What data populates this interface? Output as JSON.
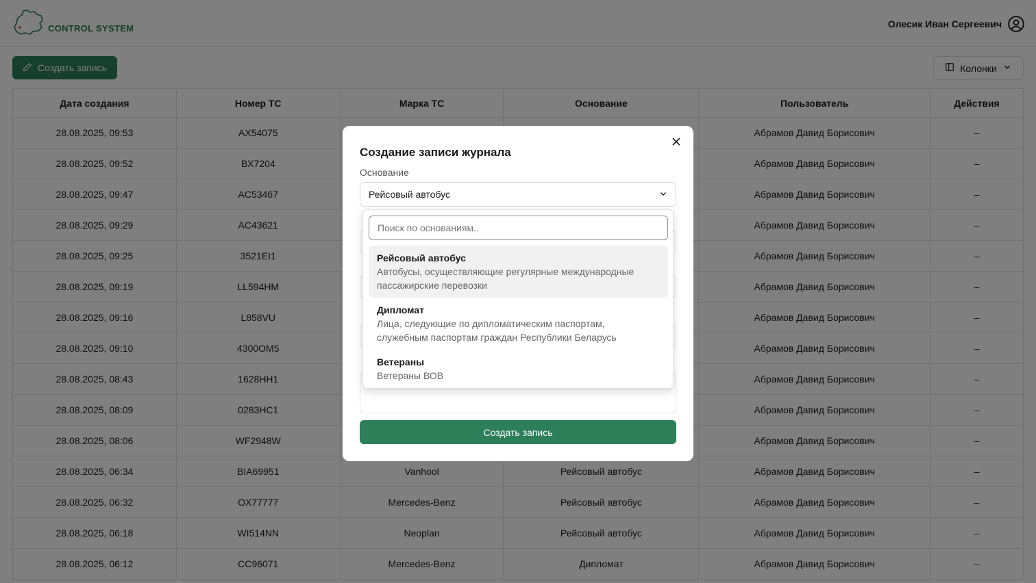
{
  "header": {
    "app_title": "CONTROL SYSTEM",
    "user_name": "Олесик Иван Сергеевич"
  },
  "toolbar": {
    "create_label": "Создать запись",
    "columns_label": "Колонки"
  },
  "table": {
    "columns": [
      "Дата создания",
      "Номер ТС",
      "Марка ТС",
      "Основание",
      "Пользователь",
      "Действия"
    ],
    "rows": [
      [
        "28.08.2025, 09:53",
        "AX54075",
        "",
        "",
        "Абрамов Давид Борисович",
        "–"
      ],
      [
        "28.08.2025, 09:52",
        "BX7204",
        "",
        "",
        "Абрамов Давид Борисович",
        "–"
      ],
      [
        "28.08.2025, 09:47",
        "AC53467",
        "",
        "",
        "Абрамов Давид Борисович",
        "–"
      ],
      [
        "28.08.2025, 09:29",
        "AC43621",
        "",
        "",
        "Абрамов Давид Борисович",
        "–"
      ],
      [
        "28.08.2025, 09:25",
        "3521EI1",
        "",
        "",
        "Абрамов Давид Борисович",
        "–"
      ],
      [
        "28.08.2025, 09:19",
        "LL594HM",
        "",
        "",
        "Абрамов Давид Борисович",
        "–"
      ],
      [
        "28.08.2025, 09:16",
        "L858VU",
        "",
        "",
        "Абрамов Давид Борисович",
        "–"
      ],
      [
        "28.08.2025, 09:10",
        "4300OM5",
        "",
        "",
        "Абрамов Давид Борисович",
        "–"
      ],
      [
        "28.08.2025, 08:43",
        "1628HH1",
        "",
        "",
        "Абрамов Давид Борисович",
        "–"
      ],
      [
        "28.08.2025, 08:09",
        "0283HC1",
        "",
        "",
        "Абрамов Давид Борисович",
        "–"
      ],
      [
        "28.08.2025, 08:06",
        "WF2948W",
        "",
        "",
        "Абрамов Давид Борисович",
        "–"
      ],
      [
        "28.08.2025, 06:34",
        "BIA69951",
        "Vanhool",
        "Рейсовый автобус",
        "Абрамов Давид Борисович",
        "–"
      ],
      [
        "28.08.2025, 06:32",
        "OX77777",
        "Mercedes-Benz",
        "Рейсовый автобус",
        "Абрамов Давид Борисович",
        "–"
      ],
      [
        "28.08.2025, 06:18",
        "WI514NN",
        "Neoplan",
        "Рейсовый автобус",
        "Абрамов Давид Борисович",
        "–"
      ],
      [
        "28.08.2025, 06:12",
        "CC96071",
        "Mercedes-Benz",
        "Дипломат",
        "Абрамов Давид Борисович",
        "–"
      ]
    ]
  },
  "modal": {
    "title": "Создание записи журнала",
    "basis_label": "Основание",
    "basis_value": "Рейсовый автобус",
    "submit_label": "Создать запись",
    "dropdown": {
      "search_placeholder": "Поиск по основаниям..",
      "options": [
        {
          "title": "Рейсовый автобус",
          "desc_line1": "Автобусы, осуществляющие регулярные международные",
          "desc_line2": "пассажирские перевозки",
          "selected": true
        },
        {
          "title": "Дипломат",
          "desc_line1": "Лица, следующие по дипломатическим паспортам,",
          "desc_line2": "служебным паспортам граждан Республики Беларусь",
          "selected": false
        },
        {
          "title": "Ветераны",
          "desc_line1": "Ветераны ВОВ",
          "desc_line2": "",
          "selected": false
        }
      ]
    }
  },
  "colors": {
    "brand_green": "#2d7f5a",
    "overlay": "rgba(0,0,0,0.5)"
  },
  "icons": {
    "logo": "map-outline-icon",
    "user": "user-circle-icon",
    "create": "pencil-icon",
    "columns": "columns-icon",
    "close": "close-icon",
    "chevron": "chevron-down-icon"
  }
}
